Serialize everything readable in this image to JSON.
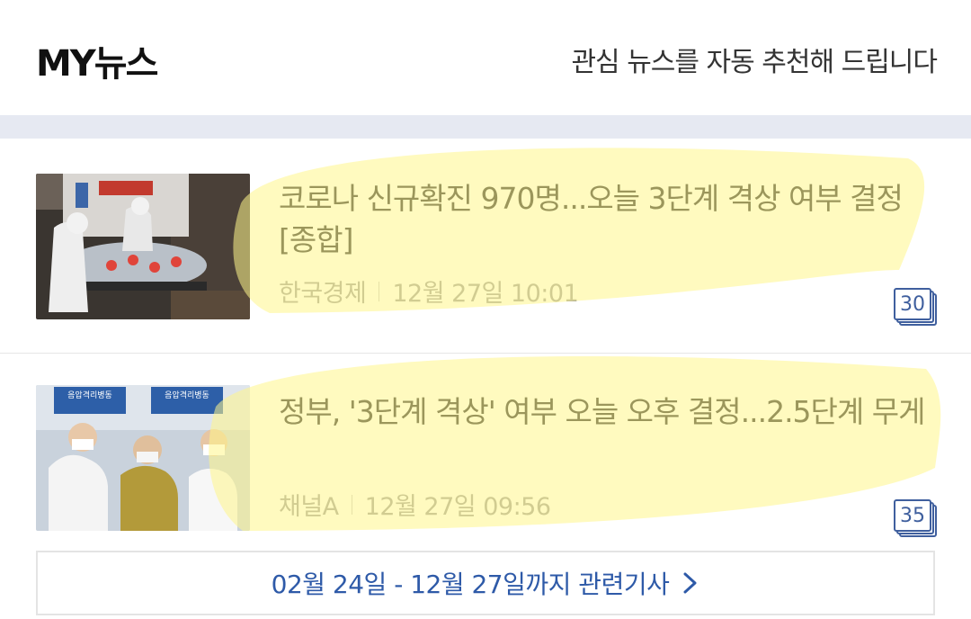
{
  "header": {
    "brand": "MY뉴스",
    "tagline": "관심 뉴스를 자동 추천해 드립니다"
  },
  "articles": [
    {
      "title": "코로나 신규확진 970명...오늘 3단계 격상 여부 결정[종합]",
      "source": "한국경제",
      "date": "12월 27일 10:01",
      "count": "30",
      "thumb_icon": "ambulance-photo-icon"
    },
    {
      "title": "정부, '3단계 격상' 여부 오늘 오후 결정...2.5단계 무게",
      "source": "채널A",
      "date": "12월 27일 09:56",
      "count": "35",
      "thumb_icon": "officials-photo-icon",
      "thumb_signs": [
        "음압격리병동",
        "음압격리병동"
      ]
    }
  ],
  "related_button": {
    "label": "02월 24일 - 12월 27일까지 관련기사"
  },
  "colors": {
    "accent": "#3f5f9e",
    "link": "#2e5aa8",
    "highlight": "#fff58a",
    "band": "#e6e9f2"
  }
}
